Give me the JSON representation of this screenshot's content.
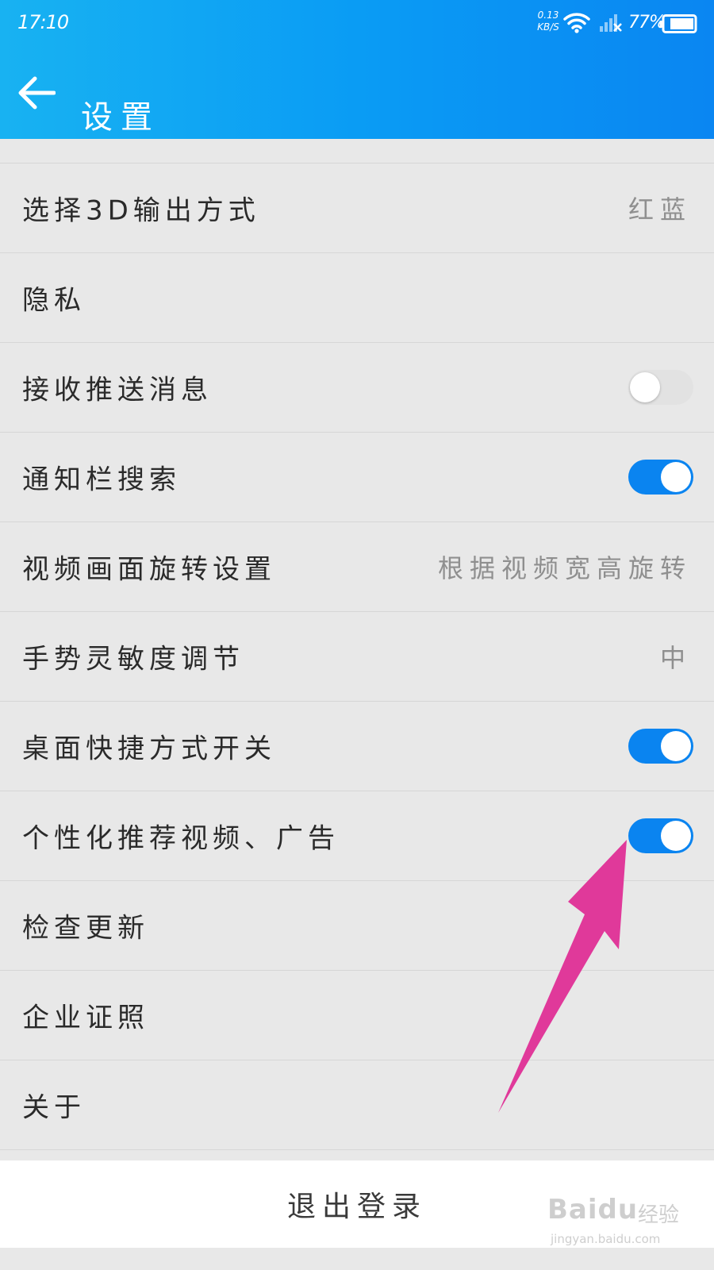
{
  "status_bar": {
    "time": "17:10",
    "net_speed_value": "0.13",
    "net_speed_unit": "KB/S",
    "battery_percent": "77%"
  },
  "header": {
    "title": "设置"
  },
  "settings": [
    {
      "label": "选择3D输出方式",
      "value": "红蓝"
    },
    {
      "label": "隐私"
    },
    {
      "label": "接收推送消息",
      "toggle": false
    },
    {
      "label": "通知栏搜索",
      "toggle": true
    },
    {
      "label": "视频画面旋转设置",
      "value": "根据视频宽高旋转"
    },
    {
      "label": "手势灵敏度调节",
      "value": "中"
    },
    {
      "label": "桌面快捷方式开关",
      "toggle": true
    },
    {
      "label": "个性化推荐视频、广告",
      "toggle": true
    },
    {
      "label": "检查更新"
    },
    {
      "label": "企业证照"
    },
    {
      "label": "关于"
    }
  ],
  "logout_label": "退出登录",
  "watermark": {
    "brand": "Baidu",
    "sub": "经验",
    "url": "jingyan.baidu.com"
  },
  "colors": {
    "header_start": "#18b2f2",
    "header_end": "#0a86f2",
    "toggle_on": "#0a84f0",
    "annotation_arrow": "#e0399a"
  }
}
